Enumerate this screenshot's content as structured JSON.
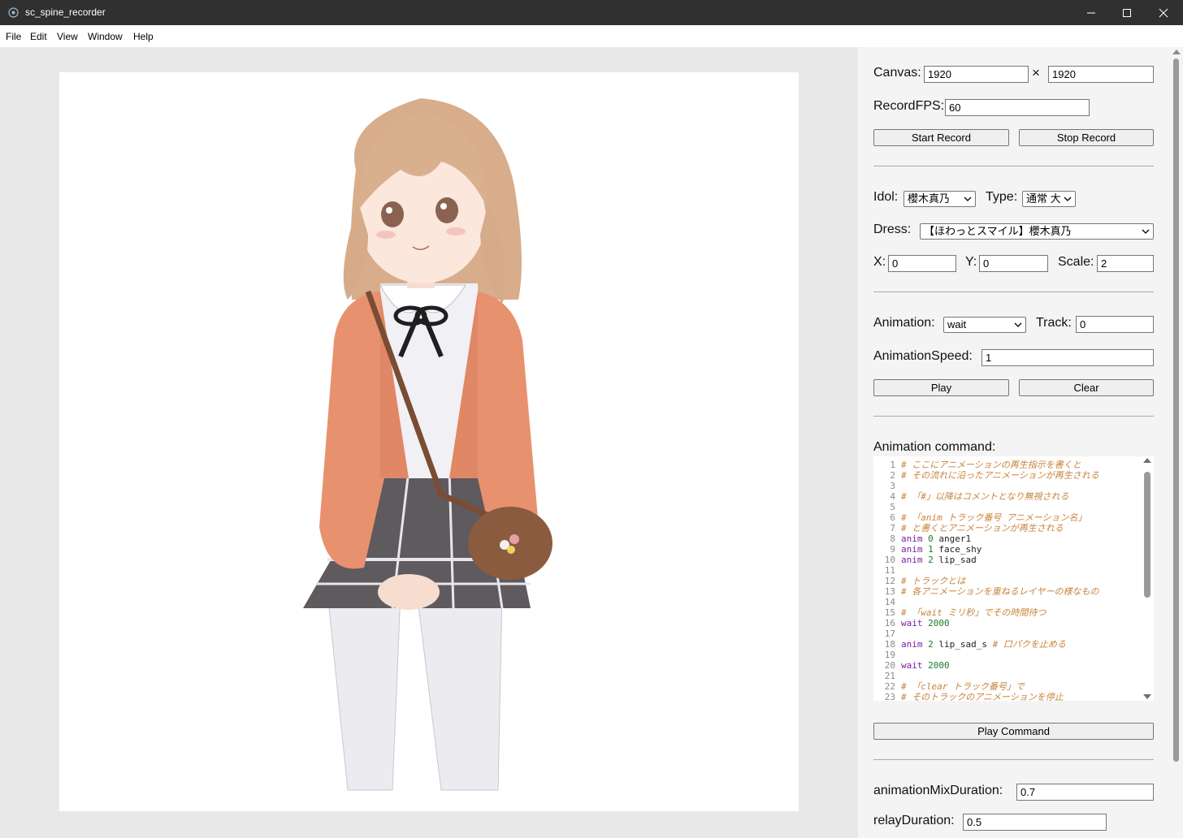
{
  "window": {
    "title": "sc_spine_recorder"
  },
  "menu": [
    "File",
    "Edit",
    "View",
    "Window",
    "Help"
  ],
  "canvas": {
    "label": "Canvas:",
    "width": "1920",
    "times": "×",
    "height": "1920"
  },
  "record": {
    "fps_label": "RecordFPS:",
    "fps": "60",
    "start_label": "Start Record",
    "stop_label": "Stop Record"
  },
  "idol": {
    "idol_label": "Idol:",
    "idol_value": "櫻木真乃",
    "type_label": "Type:",
    "type_value": "通常 大",
    "dress_label": "Dress:",
    "dress_value": "【ほわっとスマイル】櫻木真乃",
    "x_label": "X:",
    "x_value": "0",
    "y_label": "Y:",
    "y_value": "0",
    "scale_label": "Scale:",
    "scale_value": "2"
  },
  "animation": {
    "label": "Animation:",
    "value": "wait",
    "track_label": "Track:",
    "track_value": "0",
    "speed_label": "AnimationSpeed:",
    "speed_value": "1",
    "play_label": "Play",
    "clear_label": "Clear"
  },
  "command": {
    "label": "Animation command:",
    "line_numbers": [
      "1",
      "2",
      "3",
      "4",
      "5",
      "6",
      "7",
      "8",
      "9",
      "10",
      "11",
      "12",
      "13",
      "14",
      "15",
      "16",
      "17",
      "18",
      "19",
      "20",
      "21",
      "22",
      "23"
    ],
    "lines": [
      [
        {
          "t": "# ここにアニメーションの再生指示を書くと",
          "c": "comment"
        }
      ],
      [
        {
          "t": "# その流れに沿ったアニメーションが再生される",
          "c": "comment"
        }
      ],
      [],
      [
        {
          "t": "# 「#」以降はコメントとなり無視される",
          "c": "comment"
        }
      ],
      [],
      [
        {
          "t": "# 「anim トラック番号 アニメーション名」",
          "c": "comment"
        }
      ],
      [
        {
          "t": "# と書くとアニメーションが再生される",
          "c": "comment"
        }
      ],
      [
        {
          "t": "anim ",
          "c": "kw"
        },
        {
          "t": "0",
          "c": "num"
        },
        {
          "t": " anger1",
          "c": "plain"
        }
      ],
      [
        {
          "t": "anim ",
          "c": "kw"
        },
        {
          "t": "1",
          "c": "num"
        },
        {
          "t": " face_shy",
          "c": "plain"
        }
      ],
      [
        {
          "t": "anim ",
          "c": "kw"
        },
        {
          "t": "2",
          "c": "num"
        },
        {
          "t": " lip_sad",
          "c": "plain"
        }
      ],
      [],
      [
        {
          "t": "# トラックとは",
          "c": "comment"
        }
      ],
      [
        {
          "t": "# 各アニメーションを重ねるレイヤーの様なもの",
          "c": "comment"
        }
      ],
      [],
      [
        {
          "t": "# 「wait ミリ秒」でその時間待つ",
          "c": "comment"
        }
      ],
      [
        {
          "t": "wait ",
          "c": "kw"
        },
        {
          "t": "2000",
          "c": "num"
        }
      ],
      [],
      [
        {
          "t": "anim ",
          "c": "kw"
        },
        {
          "t": "2",
          "c": "num"
        },
        {
          "t": " lip_sad_s ",
          "c": "plain"
        },
        {
          "t": "# 口パクを止める",
          "c": "comment"
        }
      ],
      [],
      [
        {
          "t": "wait ",
          "c": "kw"
        },
        {
          "t": "2000",
          "c": "num"
        }
      ],
      [],
      [
        {
          "t": "# 「clear トラック番号」で",
          "c": "comment"
        }
      ],
      [
        {
          "t": "# そのトラックのアニメーションを停止",
          "c": "comment"
        }
      ]
    ],
    "play_command_label": "Play Command"
  },
  "mix": {
    "mix_label": "animationMixDuration:",
    "mix_value": "0.7",
    "relay_label": "relayDuration:",
    "relay_value": "0.5"
  },
  "icons": {
    "app": "app-icon",
    "minimize": "minimize-icon",
    "maximize": "maximize-icon",
    "close": "close-icon"
  },
  "colors": {
    "titlebar": "#303030",
    "preview_bg": "#e8e8e8",
    "panel_bg": "#f4f4f4",
    "comment": "#c8833a",
    "keyword": "#7a1fa2",
    "number": "#1b7a2e"
  }
}
